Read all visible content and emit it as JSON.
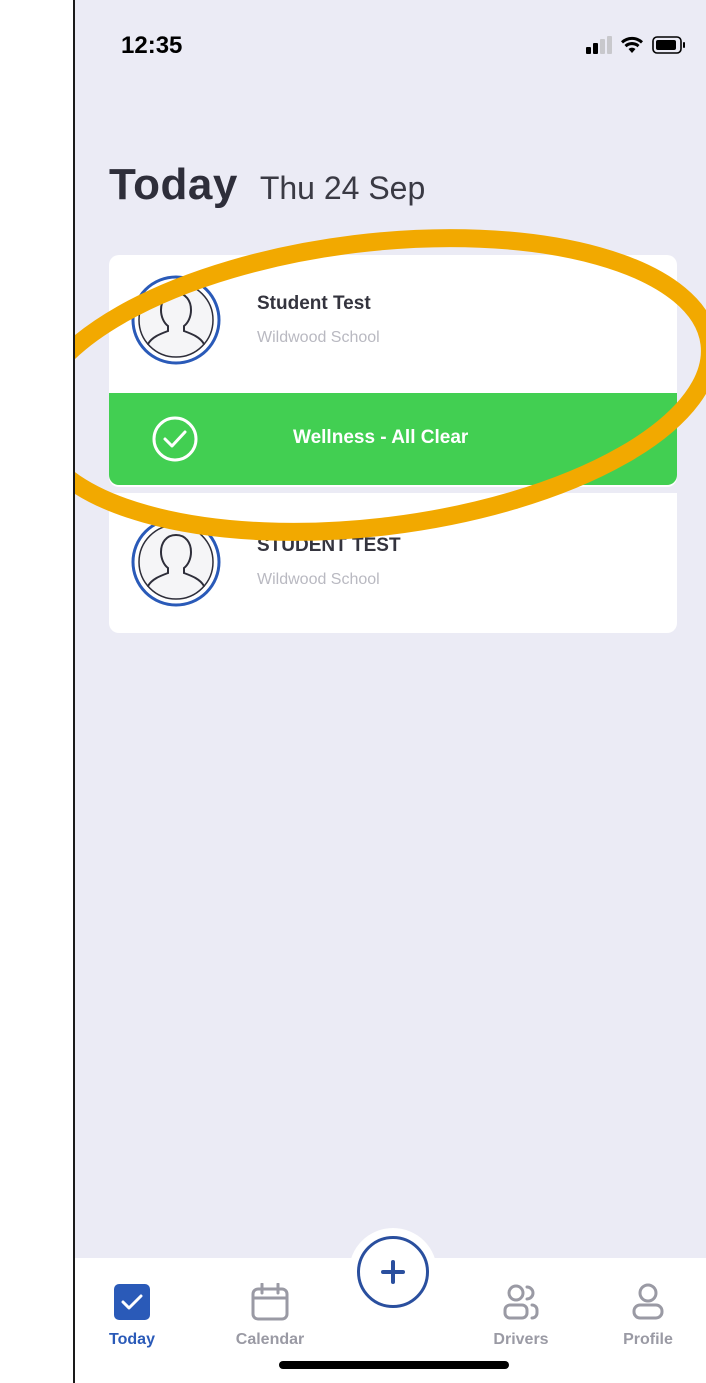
{
  "status_bar": {
    "time": "12:35",
    "icons": [
      "signal-icon",
      "wifi-icon",
      "battery-icon"
    ]
  },
  "header": {
    "title": "Today",
    "date": "Thu 24 Sep"
  },
  "cards": [
    {
      "name": "Student Test",
      "school": "Wildwood School",
      "status": "Wellness - All Clear",
      "status_color": "#42cf52"
    },
    {
      "name": "STUDENT TEST",
      "school": "Wildwood School"
    }
  ],
  "highlight_color": "#f2a900",
  "tabs": [
    {
      "label": "Today",
      "icon": "checkbox-icon",
      "active": true
    },
    {
      "label": "Calendar",
      "icon": "calendar-icon",
      "active": false
    },
    {
      "label": "Drivers",
      "icon": "drivers-icon",
      "active": false
    },
    {
      "label": "Profile",
      "icon": "profile-icon",
      "active": false
    }
  ],
  "add_button_icon": "plus-icon",
  "colors": {
    "accent": "#2a5ab8",
    "background": "#ebebf5",
    "inactive": "#9a9aa4"
  }
}
